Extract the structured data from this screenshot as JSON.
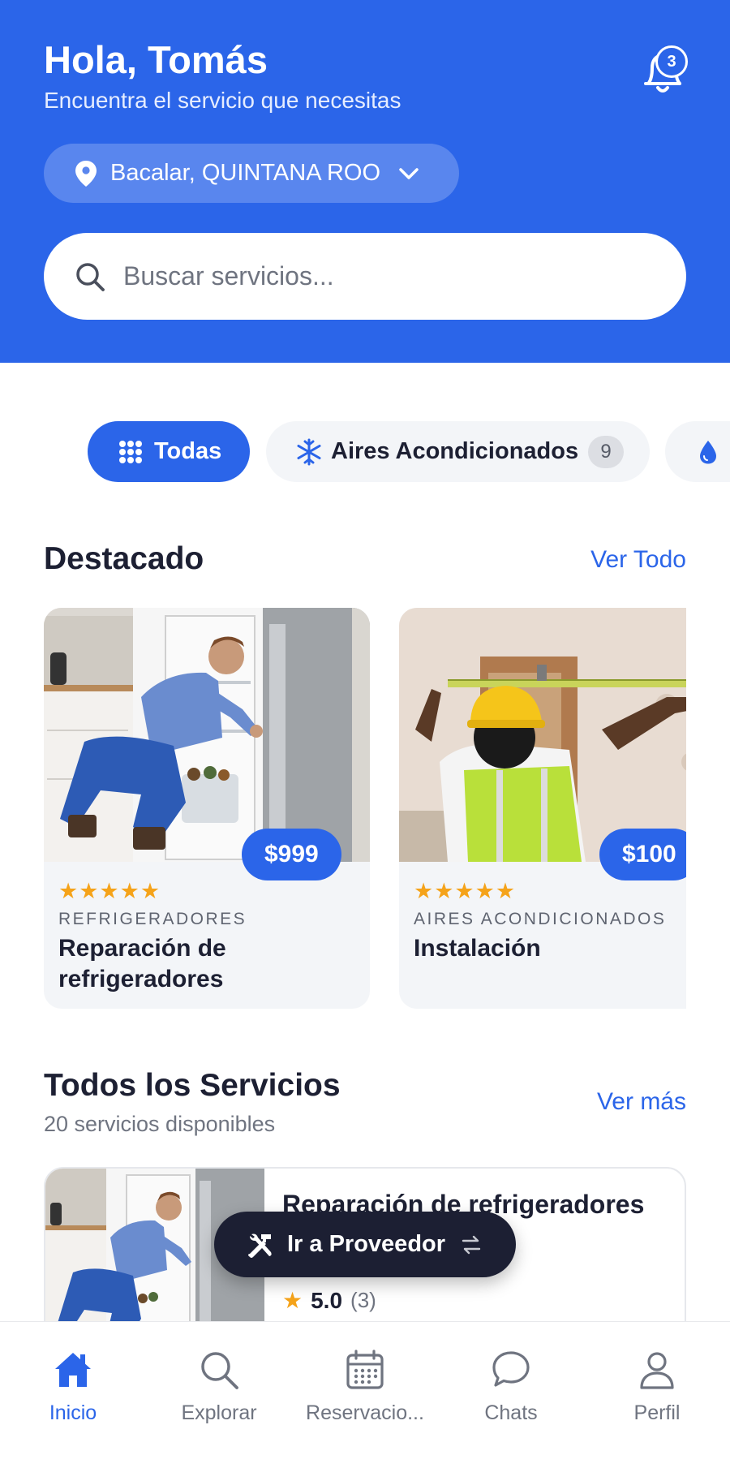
{
  "header": {
    "greeting": "Hola, Tomás",
    "subtitle": "Encuentra el servicio que necesitas",
    "notification_count": "3",
    "location": "Bacalar, QUINTANA ROO",
    "search_placeholder": "Buscar servicios..."
  },
  "categories": [
    {
      "label": "Todas",
      "icon": "grid-icon",
      "active": true
    },
    {
      "label": "Aires Acondicionados",
      "icon": "snowflake-icon",
      "count": "9"
    },
    {
      "label": "",
      "icon": "water-drop-icon"
    }
  ],
  "featured": {
    "title": "Destacado",
    "link": "Ver Todo",
    "cards": [
      {
        "price": "$999",
        "rating": "★★★★★",
        "category": "REFRIGERADORES",
        "title": "Reparación de refrigeradores"
      },
      {
        "price": "$100",
        "rating": "★★★★★",
        "category": "AIRES ACONDICIONADOS",
        "title": "Instalación"
      }
    ]
  },
  "all_services": {
    "title": "Todos los Servicios",
    "subtitle": "20 servicios disponibles",
    "link": "Ver más",
    "items": [
      {
        "title": "Reparación de refrigeradores",
        "rating": "5.0",
        "reviews": "(3)"
      }
    ]
  },
  "provider_button": "Ir a Proveedor",
  "nav": [
    {
      "label": "Inicio",
      "icon": "home-icon",
      "active": true
    },
    {
      "label": "Explorar",
      "icon": "search-icon"
    },
    {
      "label": "Reservacio...",
      "icon": "calendar-icon"
    },
    {
      "label": "Chats",
      "icon": "chat-icon"
    },
    {
      "label": "Perfil",
      "icon": "user-icon"
    }
  ],
  "colors": {
    "primary": "#2b65e9",
    "dark": "#1c1f33",
    "star": "#f5a31a"
  }
}
